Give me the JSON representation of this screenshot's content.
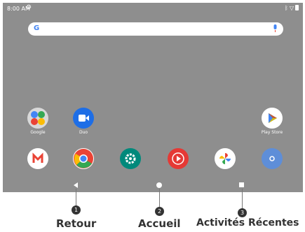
{
  "status_bar": {
    "time": "8:00 AM"
  },
  "search": {
    "logo": "G"
  },
  "top_apps": [
    {
      "label": "Google",
      "icon": "google-folder-icon"
    },
    {
      "label": "Duo",
      "icon": "duo-icon"
    },
    {
      "label": "Play Store",
      "icon": "play-store-icon"
    }
  ],
  "dock": [
    {
      "icon": "gmail-icon",
      "glyph": "M",
      "color": "#ffffff"
    },
    {
      "icon": "chrome-icon",
      "color": "#ffffff"
    },
    {
      "icon": "settings-icon",
      "glyph": "⚙",
      "color": "#00897b"
    },
    {
      "icon": "youtube-music-icon",
      "glyph": "▶",
      "color": "#e53935"
    },
    {
      "icon": "photos-icon",
      "glyph": "✿",
      "color": "#ffffff"
    },
    {
      "icon": "camera-icon",
      "glyph": "○",
      "color": "#5e8ed8"
    }
  ],
  "callouts": [
    {
      "number": "1",
      "label": "Retour"
    },
    {
      "number": "2",
      "label": "Accueil"
    },
    {
      "number": "3",
      "label": "Activités Récentes"
    }
  ]
}
